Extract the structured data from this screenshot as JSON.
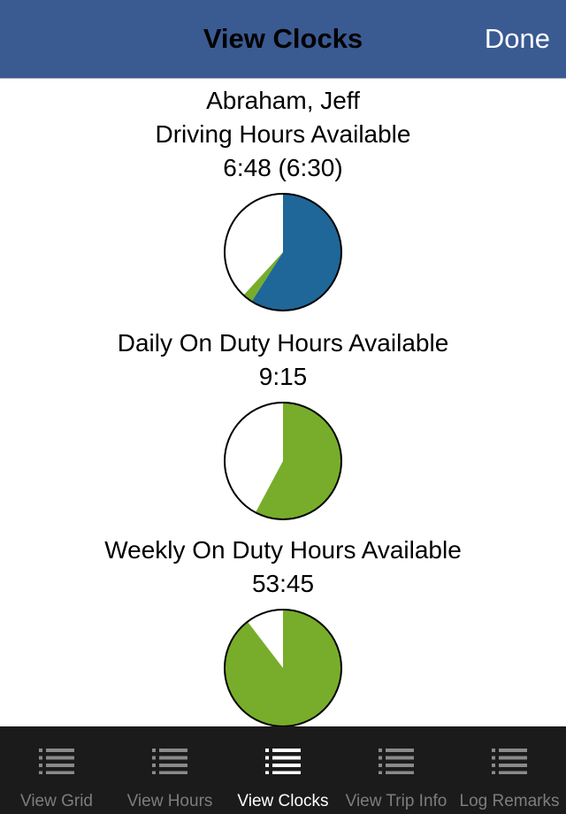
{
  "header": {
    "title": "View Clocks",
    "done_label": "Done"
  },
  "driver_name": "Abraham, Jeff",
  "colors": {
    "navbar": "#3a5a92",
    "blue": "#1f6699",
    "green": "#77ad2b",
    "empty": "#ffffff",
    "tabbar": "#1b1b1b"
  },
  "clocks": [
    {
      "title": "Driving Hours Available",
      "value": "6:48 (6:30)",
      "slices": [
        {
          "name": "blue",
          "fraction": 0.59
        },
        {
          "name": "green",
          "fraction": 0.028
        }
      ]
    },
    {
      "title": "Daily On Duty Hours Available",
      "value": "9:15",
      "slices": [
        {
          "name": "green",
          "fraction": 0.578
        }
      ]
    },
    {
      "title": "Weekly On Duty Hours Available",
      "value": "53:45",
      "slices": [
        {
          "name": "green",
          "fraction": 0.896
        }
      ]
    }
  ],
  "tabs": [
    {
      "label": "View Grid",
      "icon": "list-icon",
      "active": false
    },
    {
      "label": "View Hours",
      "icon": "list-icon",
      "active": false
    },
    {
      "label": "View Clocks",
      "icon": "list-icon",
      "active": true
    },
    {
      "label": "View Trip Info",
      "icon": "list-icon",
      "active": false
    },
    {
      "label": "Log Remarks",
      "icon": "list-icon",
      "active": false
    }
  ]
}
